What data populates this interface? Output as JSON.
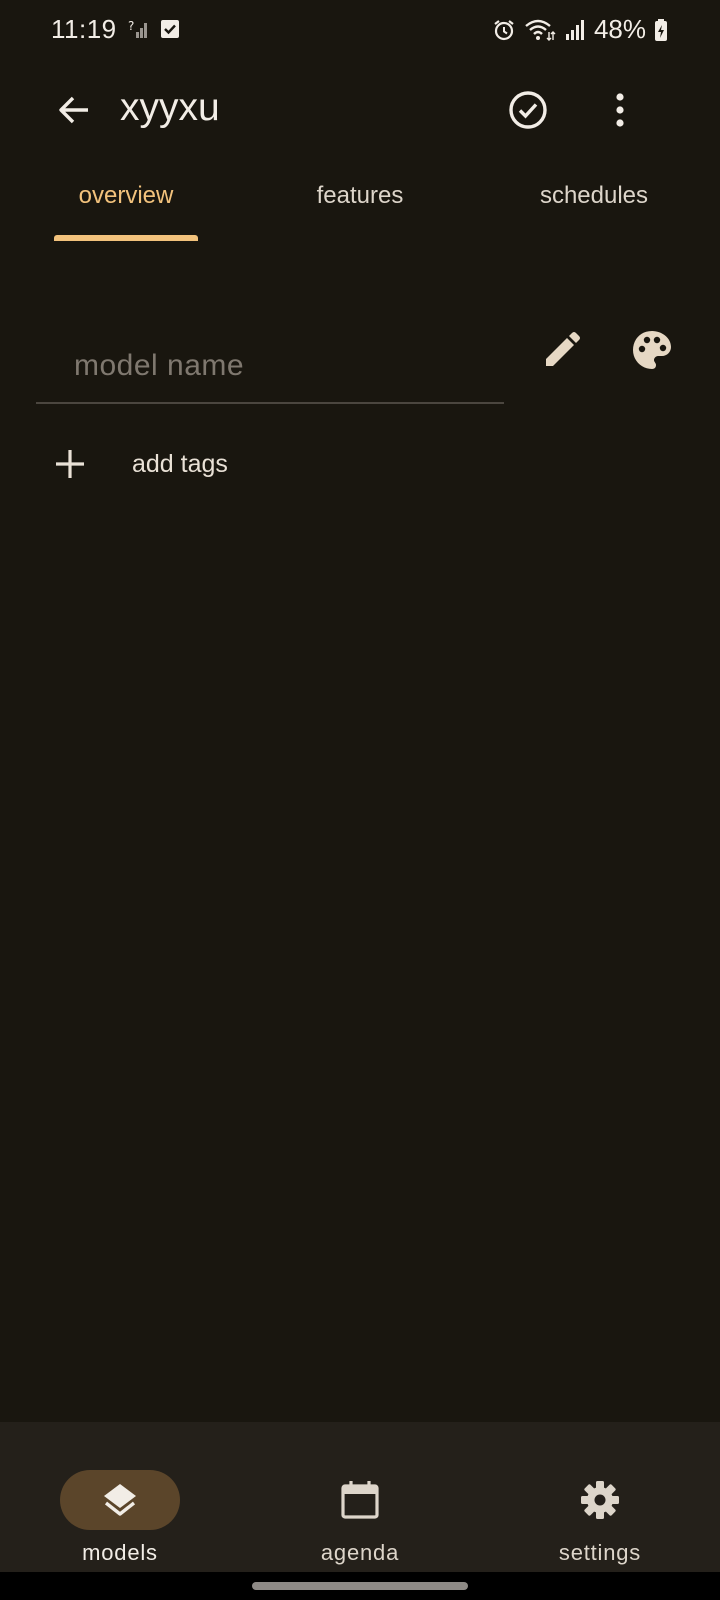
{
  "status_bar": {
    "time": "11:19",
    "battery": "48%",
    "icons": [
      "unknown-signal-icon",
      "task-check-icon",
      "alarm-icon",
      "wifi-icon",
      "cell-signal-icon",
      "battery-charging-icon"
    ]
  },
  "app_bar": {
    "title": "xyyxu",
    "back_icon": "arrow-left-icon",
    "save_icon": "check-circle-icon",
    "menu_icon": "more-vertical-icon"
  },
  "tabs": [
    {
      "label": "overview",
      "active": true
    },
    {
      "label": "features",
      "active": false
    },
    {
      "label": "schedules",
      "active": false
    }
  ],
  "form": {
    "name_value": "",
    "name_placeholder": "model name",
    "edit_icon": "pencil-icon",
    "color_icon": "palette-icon",
    "add_tags_label": "add tags",
    "add_tags_icon": "plus-icon"
  },
  "bottom_nav": {
    "items": [
      {
        "label": "models",
        "icon": "layers-icon",
        "active": true
      },
      {
        "label": "agenda",
        "icon": "calendar-icon",
        "active": false
      },
      {
        "label": "settings",
        "icon": "gear-icon",
        "active": false
      }
    ]
  },
  "colors": {
    "background": "#19160f",
    "accent": "#f2c27c",
    "nav_background": "#24201a",
    "active_pill": "#5b452a"
  }
}
